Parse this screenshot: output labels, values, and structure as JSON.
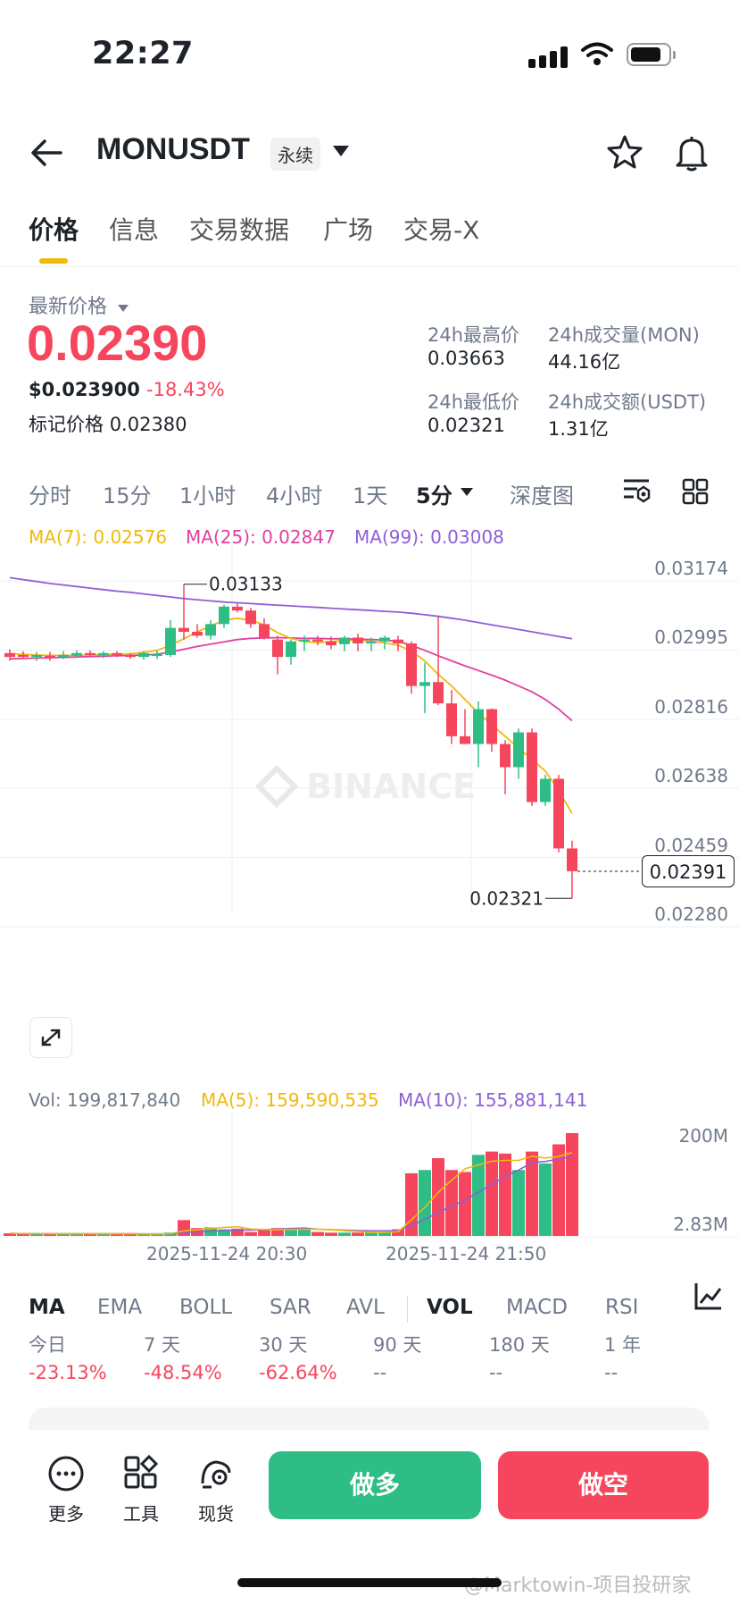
{
  "status_bar": {
    "time": "22:27"
  },
  "header": {
    "symbol": "MONUSDT",
    "badge": "永续"
  },
  "tabs": [
    "价格",
    "信息",
    "交易数据",
    "广场",
    "交易-X"
  ],
  "price": {
    "label": "最新价格",
    "last": "0.02390",
    "usd": "$0.023900",
    "change": "-18.43%",
    "mark_label": "标记价格",
    "mark": "0.02380"
  },
  "stats": {
    "high_label": "24h最高价",
    "high": "0.03663",
    "low_label": "24h最低价",
    "low": "0.02321",
    "vol_label": "24h成交量(MON)",
    "vol": "44.16亿",
    "amt_label": "24h成交额(USDT)",
    "amt": "1.31亿"
  },
  "intervals": [
    "分时",
    "15分",
    "1小时",
    "4小时",
    "1天",
    "5分",
    "深度图"
  ],
  "active_interval": "5分",
  "chart_legend": {
    "ma7": "MA(7): 0.02576",
    "ma25": "MA(25): 0.02847",
    "ma99": "MA(99): 0.03008"
  },
  "chart_annotations": {
    "high": "0.03133",
    "low": "0.02321",
    "current": "0.02391"
  },
  "watermark": "BINANCE",
  "volume_legend": {
    "vol": "Vol: 199,817,840",
    "ma5": "MA(5): 159,590,535",
    "ma10": "MA(10): 155,881,141"
  },
  "volume_axis": [
    "200M",
    "2.83M"
  ],
  "colors": {
    "up": "#2ebd85",
    "down": "#f6465d",
    "ma7": "#f0b90b",
    "ma25": "#e040a0",
    "ma99": "#8e5fd6",
    "accent": "#f0b90b"
  },
  "indicator_tabs": [
    "MA",
    "EMA",
    "BOLL",
    "SAR",
    "AVL",
    "VOL",
    "MACD",
    "RSI"
  ],
  "returns": [
    {
      "label": "今日",
      "value": "-23.13%"
    },
    {
      "label": "7 天",
      "value": "-48.54%"
    },
    {
      "label": "30 天",
      "value": "-62.64%"
    },
    {
      "label": "90 天",
      "value": "--"
    },
    {
      "label": "180 天",
      "value": "--"
    },
    {
      "label": "1 年",
      "value": "--"
    }
  ],
  "bottom_bar": {
    "more": "更多",
    "tools": "工具",
    "spot": "现货",
    "long": "做多",
    "short": "做空"
  },
  "footer_watermark": "@Marktowin-项目投研家",
  "chart_data": {
    "type": "candlestick",
    "interval": "5m",
    "y_ticks": [
      "0.03174",
      "0.02995",
      "0.02816",
      "0.02638",
      "0.02459",
      "0.02280"
    ],
    "ylim": [
      0.0228,
      0.03174
    ],
    "x_ticks": [
      "2025-11-24 20:30",
      "2025-11-24 21:50"
    ],
    "candles": [
      {
        "o": 0.02955,
        "h": 0.02965,
        "l": 0.02935,
        "c": 0.02945
      },
      {
        "o": 0.0295,
        "h": 0.0296,
        "l": 0.0294,
        "c": 0.02945
      },
      {
        "o": 0.02945,
        "h": 0.02958,
        "l": 0.02935,
        "c": 0.0295
      },
      {
        "o": 0.02948,
        "h": 0.02958,
        "l": 0.02935,
        "c": 0.02945
      },
      {
        "o": 0.02945,
        "h": 0.0296,
        "l": 0.0294,
        "c": 0.0295
      },
      {
        "o": 0.02948,
        "h": 0.02962,
        "l": 0.02942,
        "c": 0.02955
      },
      {
        "o": 0.02955,
        "h": 0.02962,
        "l": 0.02945,
        "c": 0.0295
      },
      {
        "o": 0.0295,
        "h": 0.0296,
        "l": 0.02942,
        "c": 0.02955
      },
      {
        "o": 0.02955,
        "h": 0.0296,
        "l": 0.02945,
        "c": 0.0295
      },
      {
        "o": 0.0295,
        "h": 0.02955,
        "l": 0.0294,
        "c": 0.02945
      },
      {
        "o": 0.02945,
        "h": 0.0296,
        "l": 0.02938,
        "c": 0.02955
      },
      {
        "o": 0.0295,
        "h": 0.02962,
        "l": 0.0294,
        "c": 0.02952
      },
      {
        "o": 0.0295,
        "h": 0.0304,
        "l": 0.02945,
        "c": 0.0302
      },
      {
        "o": 0.0302,
        "h": 0.03133,
        "l": 0.0299,
        "c": 0.0301
      },
      {
        "o": 0.0301,
        "h": 0.0303,
        "l": 0.02995,
        "c": 0.03
      },
      {
        "o": 0.03,
        "h": 0.0304,
        "l": 0.0299,
        "c": 0.0303
      },
      {
        "o": 0.0303,
        "h": 0.0308,
        "l": 0.0302,
        "c": 0.03075
      },
      {
        "o": 0.03075,
        "h": 0.03085,
        "l": 0.0306,
        "c": 0.03065
      },
      {
        "o": 0.03065,
        "h": 0.03072,
        "l": 0.0302,
        "c": 0.0303
      },
      {
        "o": 0.0303,
        "h": 0.03045,
        "l": 0.0299,
        "c": 0.02995
      },
      {
        "o": 0.0299,
        "h": 0.03,
        "l": 0.029,
        "c": 0.02945
      },
      {
        "o": 0.02945,
        "h": 0.0299,
        "l": 0.02925,
        "c": 0.02985
      },
      {
        "o": 0.02985,
        "h": 0.03,
        "l": 0.0296,
        "c": 0.0299
      },
      {
        "o": 0.0299,
        "h": 0.03,
        "l": 0.02975,
        "c": 0.02985
      },
      {
        "o": 0.02985,
        "h": 0.02998,
        "l": 0.02965,
        "c": 0.02975
      },
      {
        "o": 0.02978,
        "h": 0.03,
        "l": 0.0296,
        "c": 0.02995
      },
      {
        "o": 0.02995,
        "h": 0.03005,
        "l": 0.0296,
        "c": 0.0298
      },
      {
        "o": 0.0298,
        "h": 0.02995,
        "l": 0.0296,
        "c": 0.02985
      },
      {
        "o": 0.02985,
        "h": 0.03,
        "l": 0.02965,
        "c": 0.02995
      },
      {
        "o": 0.0299,
        "h": 0.03,
        "l": 0.0296,
        "c": 0.0298
      },
      {
        "o": 0.0298,
        "h": 0.02985,
        "l": 0.0285,
        "c": 0.0287
      },
      {
        "o": 0.0287,
        "h": 0.0293,
        "l": 0.028,
        "c": 0.0288
      },
      {
        "o": 0.0288,
        "h": 0.0305,
        "l": 0.0282,
        "c": 0.02825
      },
      {
        "o": 0.02825,
        "h": 0.0286,
        "l": 0.0272,
        "c": 0.0274
      },
      {
        "o": 0.0274,
        "h": 0.0281,
        "l": 0.0272,
        "c": 0.0272
      },
      {
        "o": 0.0272,
        "h": 0.0283,
        "l": 0.0266,
        "c": 0.0281
      },
      {
        "o": 0.0281,
        "h": 0.02812,
        "l": 0.027,
        "c": 0.0272
      },
      {
        "o": 0.0272,
        "h": 0.0273,
        "l": 0.0259,
        "c": 0.0266
      },
      {
        "o": 0.0266,
        "h": 0.0276,
        "l": 0.0263,
        "c": 0.0275
      },
      {
        "o": 0.0275,
        "h": 0.0276,
        "l": 0.0256,
        "c": 0.0257
      },
      {
        "o": 0.0257,
        "h": 0.0264,
        "l": 0.0256,
        "c": 0.0263
      },
      {
        "o": 0.0263,
        "h": 0.0264,
        "l": 0.0244,
        "c": 0.0245
      },
      {
        "o": 0.0245,
        "h": 0.0247,
        "l": 0.02321,
        "c": 0.02391
      }
    ],
    "ma7": [
      0.02953,
      0.02952,
      0.0295,
      0.02949,
      0.02949,
      0.02949,
      0.0295,
      0.02951,
      0.02952,
      0.02953,
      0.02957,
      0.02962,
      0.02975,
      0.02992,
      0.0301,
      0.03025,
      0.0304,
      0.03045,
      0.0304,
      0.03028,
      0.03008,
      0.02993,
      0.02985,
      0.02982,
      0.02985,
      0.02987,
      0.02988,
      0.02985,
      0.02982,
      0.02975,
      0.0296,
      0.02935,
      0.029,
      0.0287,
      0.02835,
      0.028,
      0.0277,
      0.0274,
      0.0271,
      0.0268,
      0.0265,
      0.026,
      0.0254
    ],
    "ma25": [
      0.0294,
      0.02941,
      0.02942,
      0.02943,
      0.02944,
      0.02945,
      0.02946,
      0.02947,
      0.02948,
      0.02949,
      0.0295,
      0.02952,
      0.02958,
      0.02965,
      0.02972,
      0.02978,
      0.02984,
      0.0299,
      0.02993,
      0.02994,
      0.02995,
      0.02994,
      0.02993,
      0.02993,
      0.02992,
      0.02992,
      0.02991,
      0.0299,
      0.02989,
      0.02985,
      0.02975,
      0.02962,
      0.02948,
      0.02935,
      0.02922,
      0.0291,
      0.02898,
      0.02885,
      0.0287,
      0.02855,
      0.02835,
      0.0281,
      0.0278
    ],
    "ma99": [
      0.0315,
      0.03145,
      0.0314,
      0.03135,
      0.03131,
      0.03127,
      0.03123,
      0.03119,
      0.03115,
      0.03112,
      0.03108,
      0.03104,
      0.031,
      0.03096,
      0.03093,
      0.0309,
      0.03087,
      0.03085,
      0.03083,
      0.03081,
      0.03079,
      0.03077,
      0.03075,
      0.03073,
      0.03071,
      0.03069,
      0.03067,
      0.03065,
      0.03063,
      0.03061,
      0.03058,
      0.03054,
      0.0305,
      0.03045,
      0.0304,
      0.03034,
      0.03028,
      0.03022,
      0.03016,
      0.0301,
      0.03004,
      0.02998,
      0.02992
    ],
    "volume": [
      4,
      3,
      3,
      3,
      3,
      4,
      3,
      3,
      3,
      3,
      3,
      3,
      5,
      24,
      12,
      13,
      10,
      11,
      6,
      9,
      12,
      11,
      12,
      6,
      5,
      5,
      5,
      6,
      6,
      10,
      95,
      100,
      118,
      100,
      97,
      123,
      128,
      125,
      100,
      128,
      110,
      139,
      156
    ],
    "volume_max": 160
  }
}
